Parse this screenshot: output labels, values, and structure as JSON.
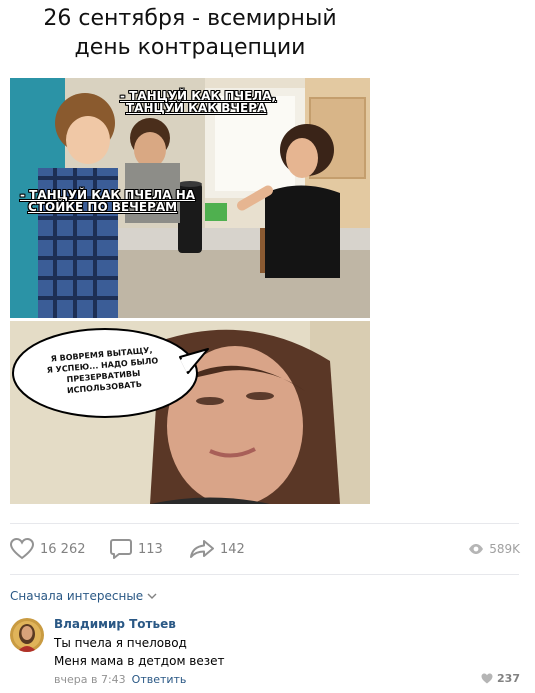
{
  "post": {
    "title_line1": "26 сентября - всемирный",
    "title_line2": "день контрацепции"
  },
  "meme": {
    "caption_top_line1": "- ТАНЦУЙ КАК ПЧЕЛА,",
    "caption_top_line2": "ТАНЦУЙ КАК ВЧЕРА",
    "caption_left_line1": "- ТАНЦУЙ КАК ПЧЕЛА НА",
    "caption_left_line2": "СТОЙКЕ ПО ВЕЧЕРАМ",
    "bubble_line1": "Я ВОВРЕМЯ ВЫТАЩУ,",
    "bubble_line2": "Я УСПЕЮ... НАДО БЫЛО",
    "bubble_line3": "ПРЕЗЕРВАТИВЫ",
    "bubble_line4": "ИСПОЛЬЗОВАТЬ"
  },
  "actions": {
    "likes": "16 262",
    "comments": "113",
    "shares": "142",
    "views": "589K"
  },
  "comments_section": {
    "sort_label": "Сначала интересные"
  },
  "comment": {
    "author": "Владимир Тотьев",
    "line1": "Ты пчела я пчеловод",
    "line2": "Меня мама в детдом везет",
    "time": "вчера в 7:43",
    "reply_label": "Ответить",
    "likes": "237"
  },
  "colors": {
    "link": "#2a5885",
    "icon_gray": "#939393",
    "muted_text": "#828282",
    "divider": "#e7e8ec"
  },
  "icons": [
    "heart-icon",
    "comment-icon",
    "share-icon",
    "eye-icon",
    "chevron-down-icon",
    "heart-small-icon"
  ]
}
